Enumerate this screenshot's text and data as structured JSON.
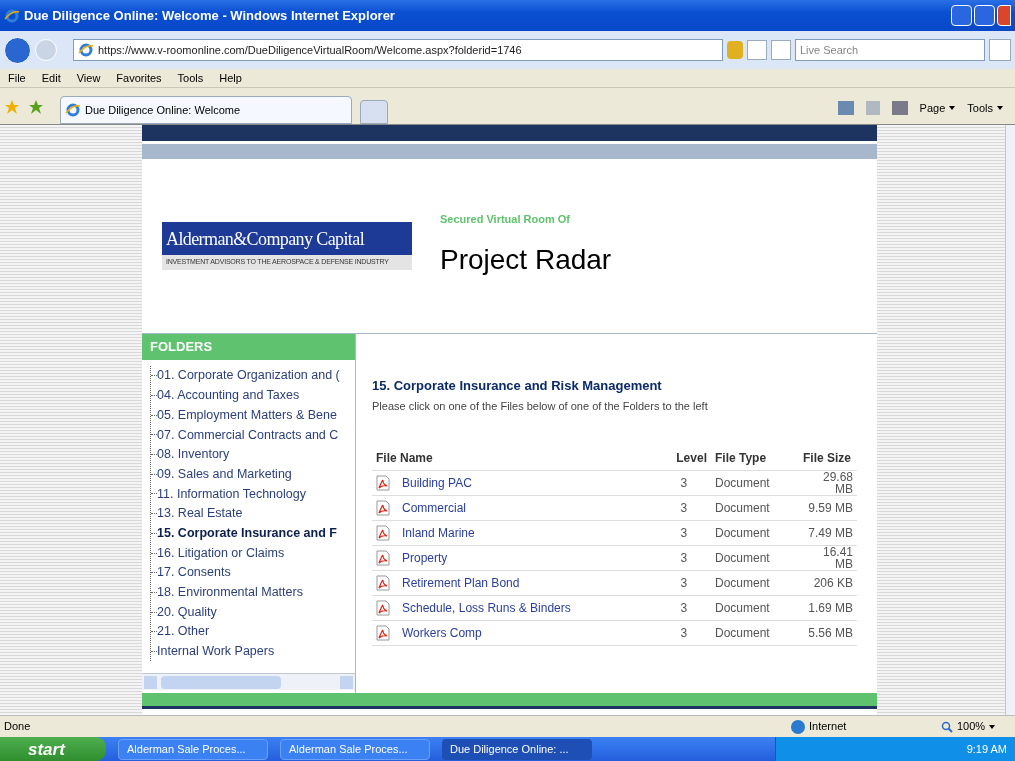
{
  "window": {
    "title": "Due Diligence Online: Welcome - Windows Internet Explorer"
  },
  "address_bar": {
    "url": "https://www.v-roomonline.com/DueDiligenceVirtualRoom/Welcome.aspx?folderid=1746"
  },
  "search": {
    "placeholder": "Live Search"
  },
  "menu": [
    "File",
    "Edit",
    "View",
    "Favorites",
    "Tools",
    "Help"
  ],
  "tabs": [
    {
      "label": "Due Diligence Online: Welcome",
      "selected": true
    }
  ],
  "command_bar": [
    "Page",
    "Tools"
  ],
  "page": {
    "logo": {
      "name": "Alderman&Company Capital",
      "tagline": "INVESTMENT ADVISORS TO THE AEROSPACE & DEFENSE INDUSTRY"
    },
    "subtitle": "Secured Virtual Room Of",
    "title": "Project Radar",
    "folders_heading": "FOLDERS",
    "folders": [
      {
        "label": "01. Corporate Organization and (",
        "selected": false
      },
      {
        "label": "04. Accounting and Taxes",
        "selected": false
      },
      {
        "label": "05. Employment Matters & Bene",
        "selected": false
      },
      {
        "label": "07. Commercial Contracts and C",
        "selected": false
      },
      {
        "label": "08. Inventory",
        "selected": false
      },
      {
        "label": "09. Sales and Marketing",
        "selected": false
      },
      {
        "label": "11. Information Technology",
        "selected": false
      },
      {
        "label": "13. Real Estate",
        "selected": false
      },
      {
        "label": "15. Corporate Insurance and F",
        "selected": true
      },
      {
        "label": "16. Litigation or Claims",
        "selected": false
      },
      {
        "label": "17. Consents",
        "selected": false
      },
      {
        "label": "18. Environmental Matters",
        "selected": false
      },
      {
        "label": "20. Quality",
        "selected": false
      },
      {
        "label": "21. Other",
        "selected": false
      },
      {
        "label": "Internal Work Papers",
        "selected": false
      }
    ],
    "folder_title": "15. Corporate Insurance and Risk Management",
    "instructions": "Please click on one of the Files below of one of the Folders to the left",
    "table": {
      "columns": [
        "File Name",
        "Level",
        "File Type",
        "File Size"
      ],
      "rows": [
        [
          "Building PAC",
          "3",
          "Document",
          "29.68 MB"
        ],
        [
          "Commercial",
          "3",
          "Document",
          "9.59 MB"
        ],
        [
          "Inland Marine",
          "3",
          "Document",
          "7.49 MB"
        ],
        [
          "Property",
          "3",
          "Document",
          "16.41 MB"
        ],
        [
          "Retirement Plan Bond",
          "3",
          "Document",
          "206 KB"
        ],
        [
          "Schedule, Loss Runs & Binders",
          "3",
          "Document",
          "1.69 MB"
        ],
        [
          "Workers Comp",
          "3",
          "Document",
          "5.56 MB"
        ]
      ]
    }
  },
  "status_bar": {
    "text": "Done",
    "zone": "Internet",
    "zoom": "100%"
  },
  "taskbar": {
    "start": "start",
    "tasks": [
      {
        "label": "Alderman Sale Proces...",
        "selected": false
      },
      {
        "label": "Alderman Sale Proces...",
        "selected": false
      },
      {
        "label": "Due Diligence Online: ...",
        "selected": true
      }
    ],
    "time": "9:19 AM"
  }
}
